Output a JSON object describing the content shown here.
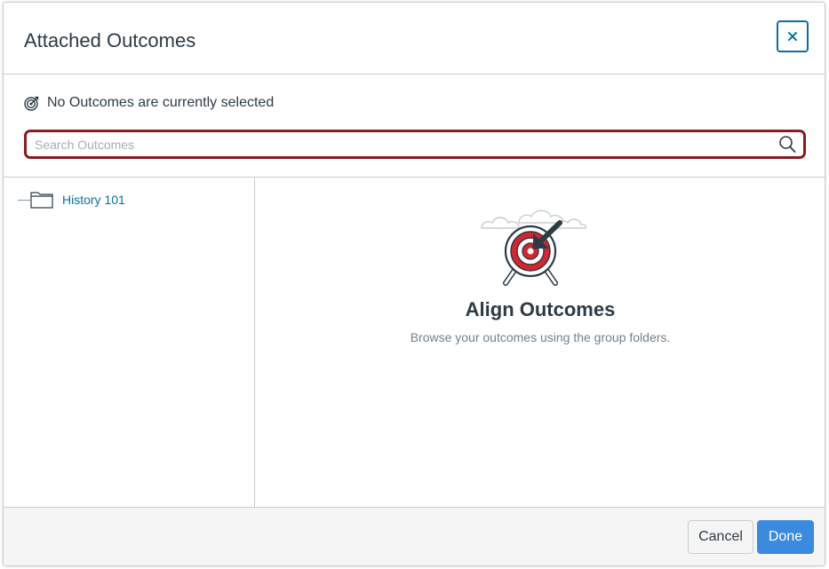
{
  "dialog": {
    "title": "Attached Outcomes",
    "close_label": "×"
  },
  "status": {
    "text": "No Outcomes are currently selected",
    "icon": "target-icon"
  },
  "search": {
    "value": "",
    "placeholder": "Search Outcomes",
    "icon": "search-icon"
  },
  "tree": {
    "items": [
      {
        "label": "History 101",
        "icon": "folder-icon"
      }
    ]
  },
  "empty_state": {
    "title": "Align Outcomes",
    "description": "Browse your outcomes using the group folders.",
    "illustration": "target-arrow-illustration"
  },
  "footer": {
    "cancel_label": "Cancel",
    "done_label": "Done"
  },
  "colors": {
    "accent": "#0770a3",
    "done_button": "#3a8ae0",
    "search_border": "#8b1b1f",
    "target_red": "#d9232d"
  }
}
